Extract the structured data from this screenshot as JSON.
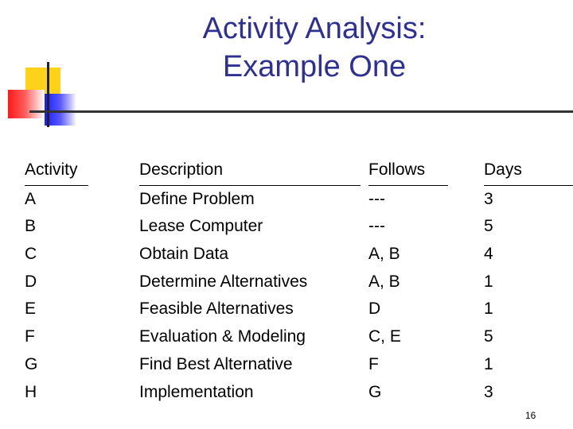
{
  "title": {
    "line1": "Activity Analysis:",
    "line2": "Example One"
  },
  "table": {
    "headers": {
      "activity": "Activity",
      "description": "Description",
      "follows": "Follows",
      "days": "Days"
    },
    "rows": [
      {
        "activity": "A",
        "description": "Define Problem",
        "follows": "---",
        "days": "3"
      },
      {
        "activity": "B",
        "description": "Lease Computer",
        "follows": "---",
        "days": "5"
      },
      {
        "activity": "C",
        "description": "Obtain Data",
        "follows": "A, B",
        "days": "4"
      },
      {
        "activity": "D",
        "description": "Determine Alternatives",
        "follows": "A, B",
        "days": "1"
      },
      {
        "activity": "E",
        "description": "Feasible Alternatives",
        "follows": "D",
        "days": "1"
      },
      {
        "activity": "F",
        "description": "Evaluation & Modeling",
        "follows": "C, E",
        "days": "5"
      },
      {
        "activity": "G",
        "description": "Find Best Alternative",
        "follows": "F",
        "days": "1"
      },
      {
        "activity": "H",
        "description": "Implementation",
        "follows": "G",
        "days": "3"
      }
    ]
  },
  "page_number": "16",
  "colors": {
    "title": "#2e3192",
    "logo_yellow": "#ffd21a",
    "logo_red": "#ff1a1a",
    "logo_blue": "#1a1aff"
  }
}
